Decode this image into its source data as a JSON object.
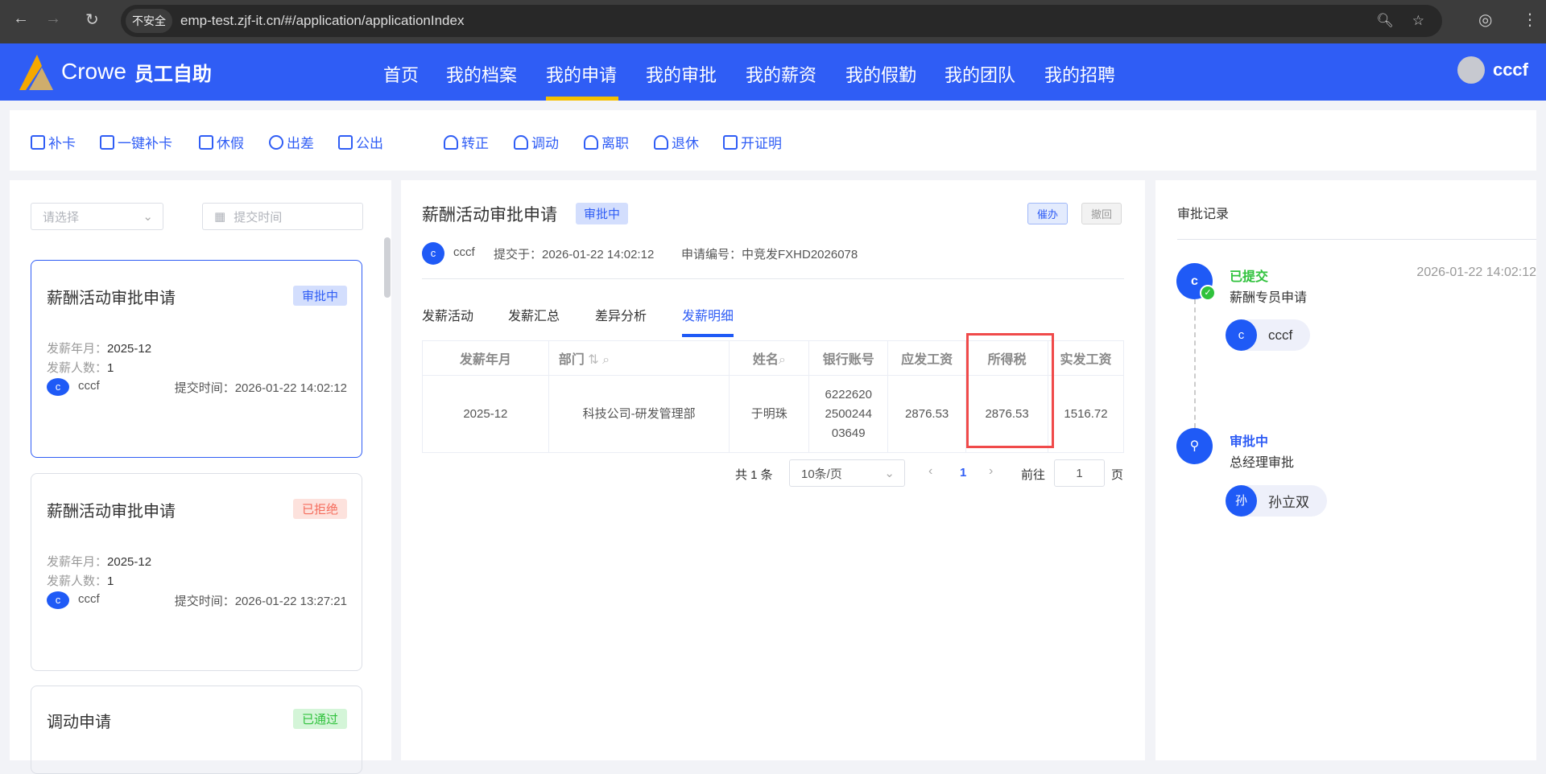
{
  "browser": {
    "insecure": "不安全",
    "url": "emp-test.zjf-it.cn/#/application/applicationIndex"
  },
  "header": {
    "brand": "Crowe",
    "app": "员工自助",
    "nav": [
      "首页",
      "我的档案",
      "我的申请",
      "我的审批",
      "我的薪资",
      "我的假勤",
      "我的团队",
      "我的招聘"
    ],
    "active": "我的申请",
    "user": "cccf"
  },
  "toolbar": [
    "补卡",
    "一键补卡",
    "休假",
    "出差",
    "公出",
    "转正",
    "调动",
    "离职",
    "退休",
    "开证明"
  ],
  "filters": {
    "select_placeholder": "请选择",
    "date_placeholder": "提交时间"
  },
  "cards": [
    {
      "title": "薪酬活动审批申请",
      "status": "审批中",
      "month_label": "发薪年月：",
      "month": "2025-12",
      "count_label": "发薪人数：",
      "count": "1",
      "avatar": "c",
      "user": "cccf",
      "time": "提交时间：2026-01-22 14:02:12"
    },
    {
      "title": "薪酬活动审批申请",
      "status": "已拒绝",
      "month_label": "发薪年月：",
      "month": "2025-12",
      "count_label": "发薪人数：",
      "count": "1",
      "avatar": "c",
      "user": "cccf",
      "time": "提交时间：2026-01-22 13:27:21"
    },
    {
      "title": "调动申请",
      "status": "已通过"
    }
  ],
  "detail": {
    "title": "薪酬活动审批申请",
    "status": "审批中",
    "urge": "催办",
    "withdraw": "撤回",
    "avatar": "c",
    "user": "cccf",
    "submitted": "提交于：2026-01-22 14:02:12",
    "code": "申请编号：中竞发FXHD2026078",
    "tabs": [
      "发薪活动",
      "发薪汇总",
      "差异分析",
      "发薪明细"
    ],
    "active_tab": "发薪明细",
    "columns": [
      "发薪年月",
      "部门",
      "姓名",
      "银行账号",
      "应发工资",
      "所得税",
      "实发工资"
    ],
    "rows": [
      [
        "2025-12",
        "科技公司-研发管理部",
        "于明珠",
        "6222620 2500244 03649",
        "2876.53",
        "2876.53",
        "1516.72"
      ]
    ],
    "pagination": {
      "total": "共 1 条",
      "page_size": "10条/页",
      "current": "1",
      "goto": "前往",
      "goto_value": "1",
      "page_unit": "页"
    }
  },
  "records": {
    "title": "审批记录",
    "items": [
      {
        "status": "已提交",
        "time": "2026-01-22 14:02:12",
        "node": "薪酬专员申请",
        "avatar": "c",
        "person": "cccf"
      },
      {
        "status": "审批中",
        "node": "总经理审批",
        "avatar": "孙",
        "person": "孙立双"
      }
    ]
  }
}
